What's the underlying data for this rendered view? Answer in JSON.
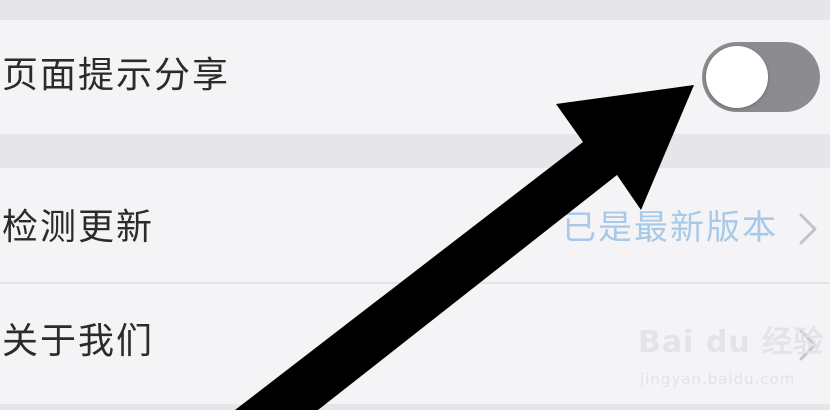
{
  "settings": {
    "page_hint_share": {
      "label": "页面提示分享",
      "toggle_on": false,
      "toggle_track_color": "#8c8c90"
    },
    "check_update": {
      "label": "检测更新",
      "value": "已是最新版本",
      "value_color": "#a8c9e8"
    },
    "about_us": {
      "label": "关于我们"
    }
  },
  "watermark": {
    "logo_text": "Bai du 经验",
    "url": "jingyan.baidu.com"
  },
  "annotation": {
    "icon": "arrow-pointer-icon",
    "color": "#000000"
  }
}
